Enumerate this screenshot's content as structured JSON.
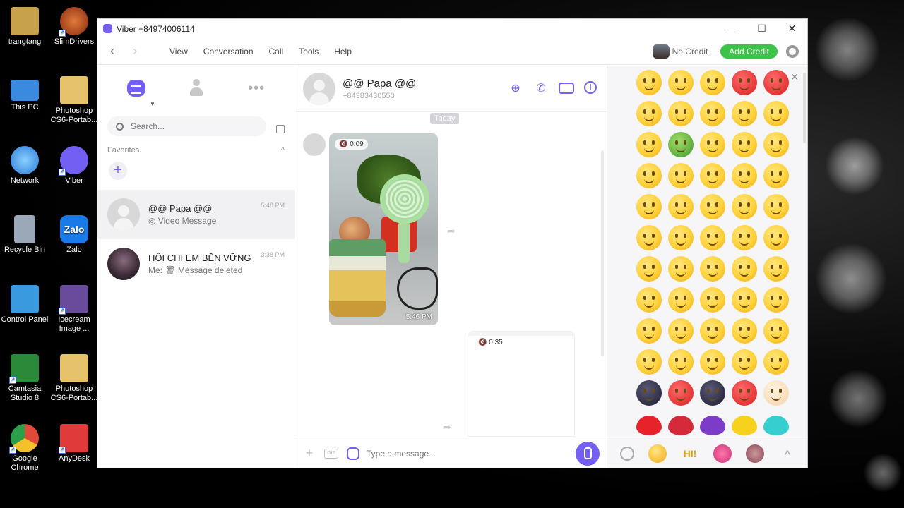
{
  "desktop": {
    "icons": [
      {
        "label": "trangtang",
        "color": "#c7a24a"
      },
      {
        "label": "SlimDrivers",
        "color": "#c8501e"
      },
      {
        "label": "This PC",
        "color": "#3a8ae0"
      },
      {
        "label": "Photoshop CS6-Portab...",
        "color": "#e6c36a"
      },
      {
        "label": "Network",
        "color": "#2a7ad8"
      },
      {
        "label": "Viber",
        "color": "#7360f2"
      },
      {
        "label": "Recycle Bin",
        "color": "#9aa8b8"
      },
      {
        "label": "Zalo",
        "color": "#1a7ae8"
      },
      {
        "label": "Control Panel",
        "color": "#3a9ae0"
      },
      {
        "label": "Icecream Image ...",
        "color": "#6a4a9a"
      },
      {
        "label": "Camtasia Studio 8",
        "color": "#2a8a3a"
      },
      {
        "label": "Photoshop CS6-Portab...",
        "color": "#e6c36a"
      },
      {
        "label": "Google Chrome",
        "color": "#e04a3a"
      },
      {
        "label": "AnyDesk",
        "color": "#e03a3a"
      }
    ],
    "zalo_text": "Zalo"
  },
  "window": {
    "title": "Viber +84974006114",
    "minimize": "—",
    "maximize": "☐",
    "close": "✕"
  },
  "menubar": {
    "back": "‹",
    "forward": "›",
    "items": [
      "View",
      "Conversation",
      "Call",
      "Tools",
      "Help"
    ],
    "credit_text": "No Credit",
    "add_credit": "Add Credit"
  },
  "left_panel": {
    "more_dots": "•••",
    "search_placeholder": "Search...",
    "favorites_label": "Favorites",
    "favorites_toggle": "^",
    "add_favorite": "+",
    "chats": [
      {
        "name": "@@ Papa @@",
        "preview": "◎ Video Message",
        "time": "5:48 PM"
      },
      {
        "name": "HỘI CHỊ EM BỀN VỮNG",
        "preview": "Me: 🗑 Message deleted",
        "time": "3:38 PM"
      }
    ]
  },
  "conversation": {
    "name": "@@ Papa @@",
    "phone": "+84383430550",
    "date_label": "Today",
    "messages": [
      {
        "type": "video",
        "duration": "0:09",
        "time": "5:46 PM"
      },
      {
        "type": "video",
        "duration": "0:35"
      }
    ],
    "share_icon": "➦",
    "composer_placeholder": "Type a message...",
    "composer_plus": "+",
    "gif_label": "GIF"
  },
  "emoji_panel": {
    "close": "✕",
    "rows": 12,
    "tabs": {
      "hi": "HI!",
      "up": "^"
    }
  },
  "colors": {
    "viber_purple": "#7360f2",
    "credit_green": "#3cc44a"
  }
}
